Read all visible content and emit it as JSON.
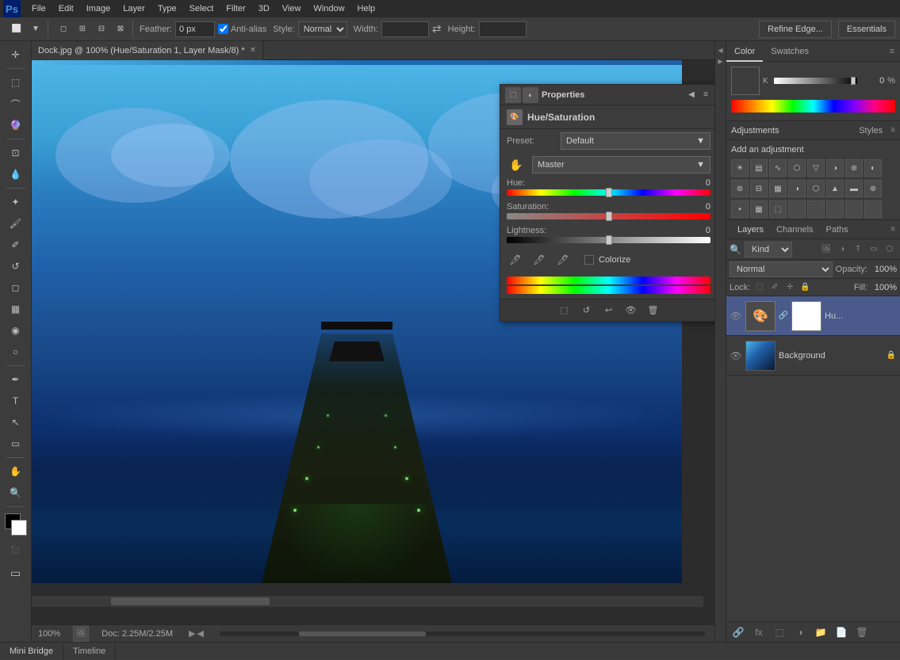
{
  "app": {
    "title": "Photoshop",
    "logo": "Ps"
  },
  "menu": {
    "items": [
      "File",
      "Edit",
      "Image",
      "Layer",
      "Type",
      "Select",
      "Filter",
      "3D",
      "View",
      "Window",
      "Help"
    ]
  },
  "toolbar": {
    "feather_label": "Feather:",
    "feather_value": "0 px",
    "anti_alias_label": "Anti-alias",
    "style_label": "Style:",
    "style_value": "Normal",
    "width_label": "Width:",
    "height_label": "Height:",
    "refine_edge": "Refine Edge...",
    "essentials": "Essentials"
  },
  "document": {
    "tab_name": "Dock.jpg @ 100% (Hue/Saturation 1, Layer Mask/8) *"
  },
  "properties_panel": {
    "title": "Properties",
    "adjustment_name": "Hue/Saturation",
    "preset_label": "Preset:",
    "preset_value": "Default",
    "channel_label": "Master",
    "hue_label": "Hue:",
    "hue_value": "0",
    "saturation_label": "Saturation:",
    "saturation_value": "0",
    "lightness_label": "Lightness:",
    "lightness_value": "0",
    "colorize_label": "Colorize"
  },
  "color_panel": {
    "tab_color": "Color",
    "tab_swatches": "Swatches",
    "k_label": "K",
    "k_value": "0",
    "k_percent": "%"
  },
  "adjustments_panel": {
    "title": "Adjustments",
    "styles_tab": "Styles",
    "add_label": "Add an adjustment"
  },
  "layers_panel": {
    "title": "Layers",
    "channels_tab": "Channels",
    "paths_tab": "Paths",
    "kind_label": "Kind",
    "blend_mode": "Normal",
    "opacity_label": "Opacity:",
    "opacity_value": "100%",
    "lock_label": "Lock:",
    "fill_label": "Fill:",
    "fill_value": "100%",
    "layers": [
      {
        "name": "Hu...",
        "type": "adjustment",
        "visible": true,
        "has_mask": true
      },
      {
        "name": "Background",
        "type": "raster",
        "visible": true,
        "locked": true
      }
    ]
  },
  "status_bar": {
    "zoom": "100%",
    "doc_size": "Doc: 2.25M/2.25M"
  },
  "bottom_tabs": {
    "mini_bridge": "Mini Bridge",
    "timeline": "Timeline"
  }
}
